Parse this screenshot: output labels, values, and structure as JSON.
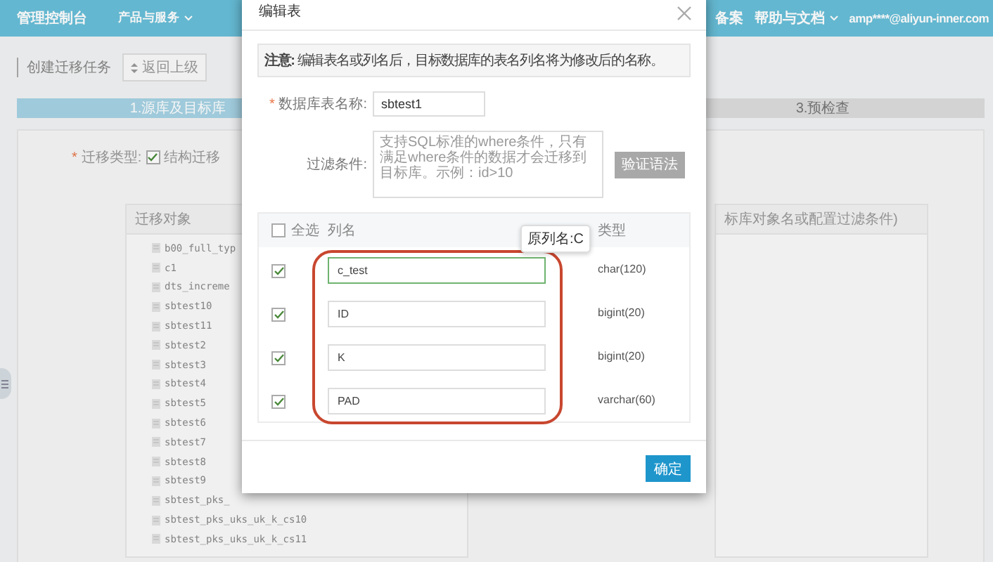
{
  "topbar": {
    "left": [
      {
        "label": "管理控制台",
        "dropdown": false
      },
      {
        "label": "产品与服务",
        "dropdown": true
      }
    ],
    "right": [
      {
        "label": "备案",
        "dropdown": false
      },
      {
        "label": "帮助与文档",
        "dropdown": true
      },
      {
        "label": "amp****@aliyun-inner.com",
        "dropdown": false
      }
    ]
  },
  "page": {
    "title": "创建迁移任务",
    "back_button": "返回上级",
    "steps": [
      {
        "label": "1.源库及目标库",
        "selected": true
      },
      {
        "label": "3.预检查",
        "selected": false
      }
    ],
    "migration_type": {
      "required_mark": "*",
      "label": "迁移类型:",
      "option": "结构迁移",
      "checked": true
    },
    "objects_panel": {
      "title": "迁移对象",
      "items": [
        "b00_full_typ",
        "c1",
        "dts_increme",
        "sbtest10",
        "sbtest11",
        "sbtest2",
        "sbtest3",
        "sbtest4",
        "sbtest5",
        "sbtest6",
        "sbtest7",
        "sbtest8",
        "sbtest9",
        "sbtest_pks_",
        "sbtest_pks_uks_uk_k_cs10",
        "sbtest_pks_uks_uk_k_cs11"
      ]
    },
    "target_panel": {
      "title": "标库对象名或配置过滤条件)"
    }
  },
  "dialog": {
    "title": "编辑表",
    "notice": "**注意:** 编辑表名或列名后，目标数据库的表名列名将为修改后的名称。",
    "table_name": {
      "required_mark": "*",
      "label": "数据库表名称:",
      "value": "sbtest1"
    },
    "filter": {
      "label": "过滤条件:",
      "placeholder": "支持SQL标准的where条件，只有满足where条件的数据才会迁移到目标库。示例：id>10",
      "button": "验证语法",
      "button_disabled": true
    },
    "columns": {
      "select_all": {
        "label": "全选",
        "checked": false
      },
      "headers": [
        "列名",
        "类型"
      ],
      "rows": [
        {
          "checked": true,
          "name": "c_test",
          "type": "char(120)",
          "focused": true
        },
        {
          "checked": true,
          "name": "ID",
          "type": "bigint(20)",
          "focused": false
        },
        {
          "checked": true,
          "name": "K",
          "type": "bigint(20)",
          "focused": false
        },
        {
          "checked": true,
          "name": "PAD",
          "type": "varchar(60)",
          "focused": false
        }
      ]
    },
    "tooltip": "原列名:C",
    "confirm_button": "确定"
  }
}
